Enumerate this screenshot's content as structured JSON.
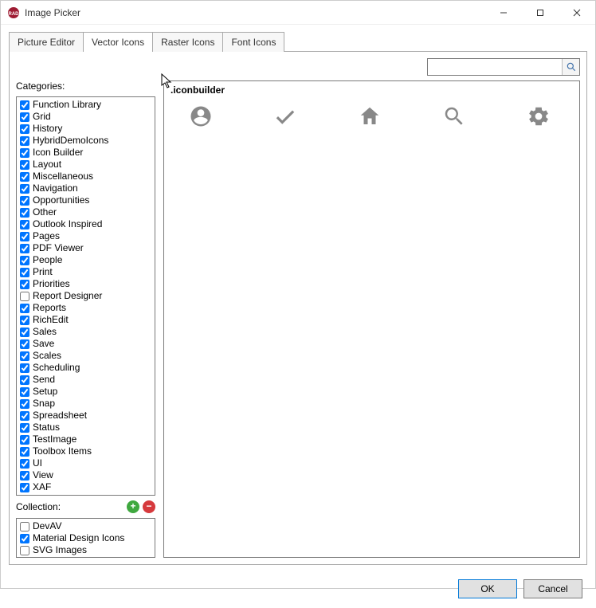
{
  "window": {
    "title": "Image Picker"
  },
  "tabs": [
    "Picture Editor",
    "Vector Icons",
    "Raster Icons",
    "Font Icons"
  ],
  "active_tab": "Vector Icons",
  "labels": {
    "categories": "Categories:",
    "collection": "Collection:",
    "ok": "OK",
    "cancel": "Cancel"
  },
  "search": {
    "value": ""
  },
  "categories": [
    {
      "label": "Function Library",
      "checked": true
    },
    {
      "label": "Grid",
      "checked": true
    },
    {
      "label": "History",
      "checked": true
    },
    {
      "label": "HybridDemoIcons",
      "checked": true
    },
    {
      "label": "Icon Builder",
      "checked": true
    },
    {
      "label": "Layout",
      "checked": true
    },
    {
      "label": "Miscellaneous",
      "checked": true
    },
    {
      "label": "Navigation",
      "checked": true
    },
    {
      "label": "Opportunities",
      "checked": true
    },
    {
      "label": "Other",
      "checked": true
    },
    {
      "label": "Outlook Inspired",
      "checked": true
    },
    {
      "label": "Pages",
      "checked": true
    },
    {
      "label": "PDF Viewer",
      "checked": true
    },
    {
      "label": "People",
      "checked": true
    },
    {
      "label": "Print",
      "checked": true
    },
    {
      "label": "Priorities",
      "checked": true
    },
    {
      "label": "Report Designer",
      "checked": false
    },
    {
      "label": "Reports",
      "checked": true
    },
    {
      "label": "RichEdit",
      "checked": true
    },
    {
      "label": "Sales",
      "checked": true
    },
    {
      "label": "Save",
      "checked": true
    },
    {
      "label": "Scales",
      "checked": true
    },
    {
      "label": "Scheduling",
      "checked": true
    },
    {
      "label": "Send",
      "checked": true
    },
    {
      "label": "Setup",
      "checked": true
    },
    {
      "label": "Snap",
      "checked": true
    },
    {
      "label": "Spreadsheet",
      "checked": true
    },
    {
      "label": "Status",
      "checked": true
    },
    {
      "label": "TestImage",
      "checked": true
    },
    {
      "label": "Toolbox Items",
      "checked": true
    },
    {
      "label": "UI",
      "checked": true
    },
    {
      "label": "View",
      "checked": true
    },
    {
      "label": "XAF",
      "checked": true
    }
  ],
  "collections": [
    {
      "label": "DevAV",
      "checked": false
    },
    {
      "label": "Material Design Icons",
      "checked": true
    },
    {
      "label": "SVG Images",
      "checked": false
    }
  ],
  "icon_group": {
    "header": ".iconbuilder",
    "items": [
      "account-circle-icon",
      "checkmark-icon",
      "home-icon",
      "search-icon",
      "settings-icon"
    ]
  }
}
